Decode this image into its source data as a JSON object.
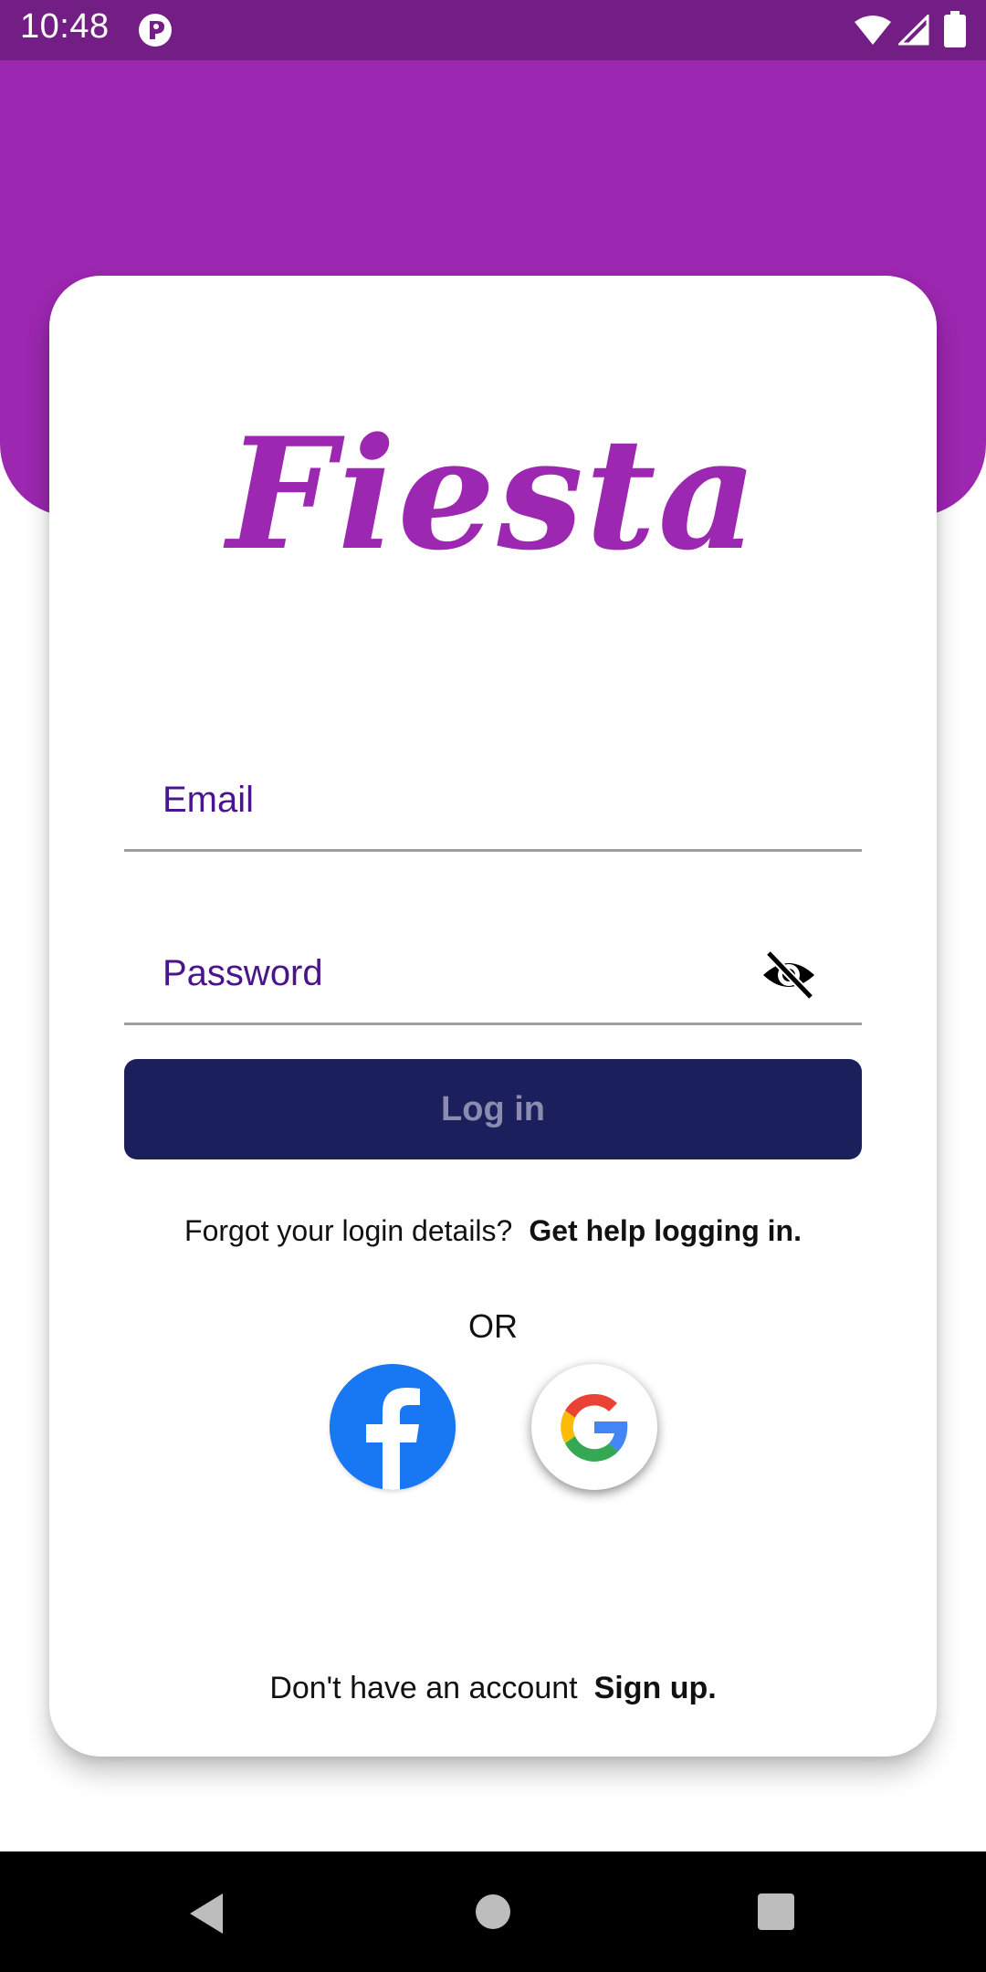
{
  "status_bar": {
    "time": "10:48",
    "app_icon": "app-notification-icon",
    "icons": [
      "wifi-icon",
      "signal-icon",
      "battery-icon"
    ]
  },
  "app": {
    "logo_text": "Fiesta",
    "brand_color": "#9c27b0"
  },
  "form": {
    "email_label": "Email",
    "password_label": "Password",
    "password_toggle_icon": "eye-off-icon",
    "login_label": "Log in"
  },
  "help": {
    "prompt": "Forgot your login details?",
    "link": "Get help logging in."
  },
  "social": {
    "divider": "OR",
    "providers": [
      "facebook-icon",
      "google-icon"
    ]
  },
  "signup": {
    "prompt": "Don't have an account",
    "link": "Sign up."
  },
  "colors": {
    "status_bar": "#731e85",
    "header": "#9c27b0",
    "field_label": "#4a148c",
    "login_button": "#1b1f5c",
    "facebook": "#1877f2"
  },
  "nav_bar": {
    "buttons": [
      "back-icon",
      "home-icon",
      "recents-icon"
    ]
  }
}
